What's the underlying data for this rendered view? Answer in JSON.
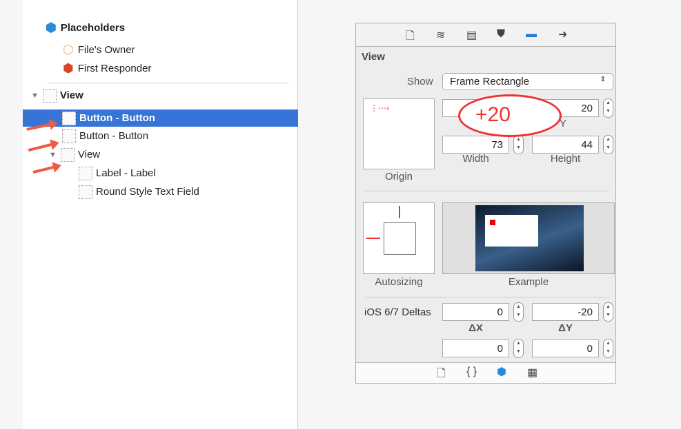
{
  "outline": {
    "placeholders": "Placeholders",
    "files_owner": "File's Owner",
    "first_responder": "First Responder",
    "view": "View",
    "items": [
      {
        "label": "Button - Button",
        "selected": true
      },
      {
        "label": "Button - Button",
        "selected": false
      },
      {
        "label": "View",
        "selected": false
      },
      {
        "label": "Label - Label",
        "selected": false
      },
      {
        "label": "Round Style Text Field",
        "selected": false
      }
    ]
  },
  "inspector": {
    "tabs": [
      "file-icon",
      "quick-help-icon",
      "identity-icon",
      "attributes-icon",
      "size-ruler-icon",
      "connections-icon"
    ],
    "section": "View",
    "show_label": "Show",
    "show_value": "Frame Rectangle",
    "y": "20",
    "y_label": "Y",
    "width": "73",
    "width_label": "Width",
    "height": "44",
    "height_label": "Height",
    "origin_label": "Origin",
    "autosizing_label": "Autosizing",
    "example_label": "Example",
    "deltas_label": "iOS 6/7 Deltas",
    "dx": "0",
    "dx_label": "ΔX",
    "dy": "-20",
    "dy_label": "ΔY",
    "dw": "0",
    "dh": "0",
    "callout": "+20",
    "bottom_tabs": [
      "file-template-icon",
      "code-snippet-icon",
      "object-library-icon",
      "media-library-icon"
    ]
  },
  "colors": {
    "selection": "#3675d8",
    "annotation": "#ee3333"
  }
}
